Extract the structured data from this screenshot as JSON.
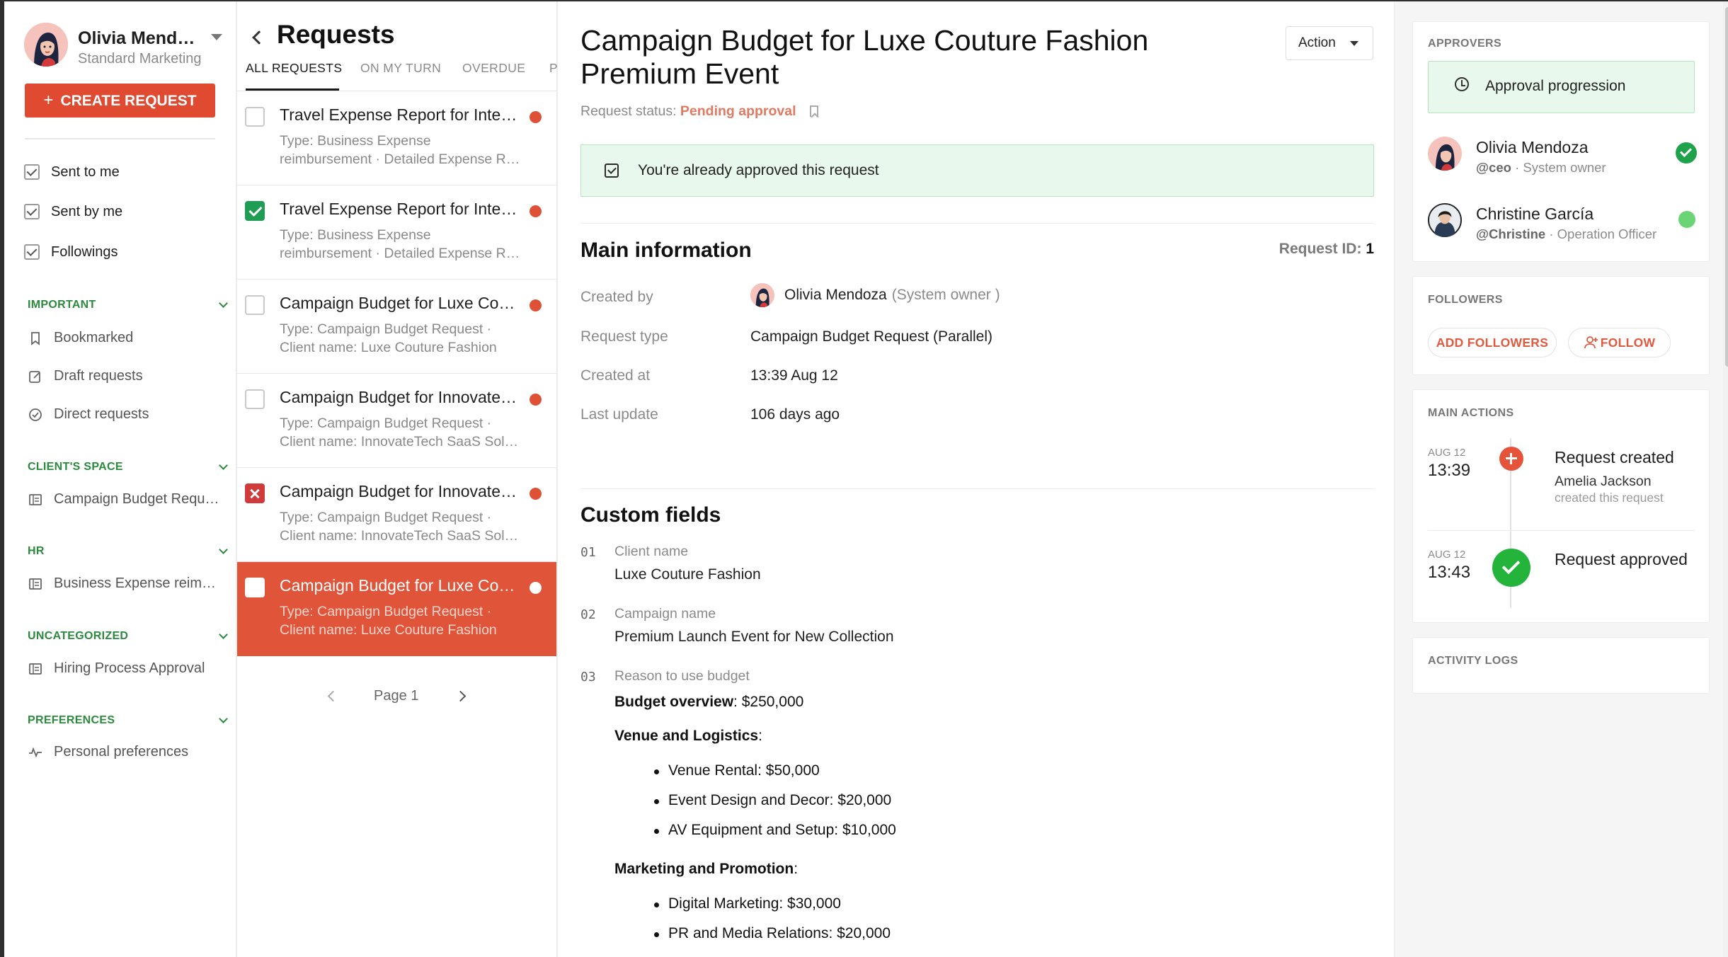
{
  "user": {
    "name": "Olivia Mendoza",
    "role": "Standard Marketing"
  },
  "sidebar": {
    "create_label": "CREATE REQUEST",
    "filters": [
      {
        "label": "Sent to me",
        "checked": true
      },
      {
        "label": "Sent by me",
        "checked": true
      },
      {
        "label": "Followings",
        "checked": true
      }
    ],
    "sections": [
      {
        "title": "IMPORTANT",
        "items": [
          {
            "label": "Bookmarked",
            "icon": "bookmark-icon"
          },
          {
            "label": "Draft requests",
            "icon": "edit-icon"
          },
          {
            "label": "Direct requests",
            "icon": "check-circle-icon"
          }
        ]
      },
      {
        "title": "CLIENT'S SPACE",
        "items": [
          {
            "label": "Campaign Budget Request",
            "icon": "form-icon"
          }
        ]
      },
      {
        "title": "HR",
        "items": [
          {
            "label": "Business Expense reimbursement",
            "icon": "form-icon"
          }
        ]
      },
      {
        "title": "UNCATEGORIZED",
        "items": [
          {
            "label": "Hiring Process Approval",
            "icon": "form-icon"
          }
        ]
      },
      {
        "title": "PREFERENCES",
        "items": [
          {
            "label": "Personal preferences",
            "icon": "pulse-icon"
          }
        ]
      }
    ]
  },
  "list": {
    "title": "Requests",
    "tabs": [
      "ALL REQUESTS",
      "ON MY TURN",
      "OVERDUE",
      "P"
    ],
    "items": [
      {
        "title": "Travel Expense Report for International Conference",
        "sub1": "Type: Business Expense",
        "sub2": "reimbursement · Detailed Expense Report",
        "state": "unchecked"
      },
      {
        "title": "Travel Expense Report for International Conference",
        "sub1": "Type: Business Expense",
        "sub2": "reimbursement · Detailed Expense Report",
        "state": "checked"
      },
      {
        "title": "Campaign Budget for Luxe Couture Fashion",
        "sub1": "Type: Campaign Budget Request ·",
        "sub2": "Client name: Luxe Couture Fashion",
        "state": "unchecked"
      },
      {
        "title": "Campaign Budget for InnovateTech SaaS",
        "sub1": "Type: Campaign Budget Request ·",
        "sub2": "Client name: InnovateTech SaaS Solutions",
        "state": "unchecked"
      },
      {
        "title": "Campaign Budget for InnovateTech SaaS",
        "sub1": "Type: Campaign Budget Request ·",
        "sub2": "Client name: InnovateTech SaaS Solutions",
        "state": "rejected"
      },
      {
        "title": "Campaign Budget for Luxe Couture Fashion",
        "sub1": "Type: Campaign Budget Request ·",
        "sub2": "Client name: Luxe Couture Fashion",
        "state": "selected"
      }
    ],
    "page_label": "Page 1"
  },
  "detail": {
    "title": "Campaign Budget for Luxe Couture Fashion Premium Event",
    "action_label": "Action",
    "status_label": "Request status:",
    "status_value": "Pending approval",
    "banner": "You're already approved this request",
    "main_info_title": "Main information",
    "request_id_label": "Request ID:",
    "request_id": "1",
    "info": {
      "created_by_label": "Created by",
      "created_by": "Olivia Mendoza",
      "created_by_role": "(System owner )",
      "type_label": "Request type",
      "type": "Campaign Budget Request  (Parallel)",
      "created_at_label": "Created at",
      "created_at": "13:39 Aug 12",
      "updated_label": "Last update",
      "updated": "106 days ago"
    },
    "custom_title": "Custom fields",
    "fields": [
      {
        "num": "01",
        "label": "Client name",
        "value": "Luxe Couture Fashion"
      },
      {
        "num": "02",
        "label": "Campaign name",
        "value": "Premium Launch Event for New Collection"
      },
      {
        "num": "03",
        "label": "Reason to use budget"
      }
    ],
    "budget": {
      "overview_label": "Budget overview",
      "overview_value": ": $250,000",
      "venue_label": "Venue and Logistics",
      "venue_items": [
        "Venue Rental: $50,000",
        "Event Design and Decor: $20,000",
        "AV Equipment and Setup: $10,000"
      ],
      "marketing_label": "Marketing and Promotion",
      "marketing_items": [
        "Digital Marketing: $30,000",
        "PR and Media Relations: $20,000"
      ]
    }
  },
  "right": {
    "approvers_title": "APPROVERS",
    "progression": "Approval progression",
    "approvers": [
      {
        "name": "Olivia Mendoza",
        "handle": "@ceo",
        "role": "· System owner",
        "status": "approved"
      },
      {
        "name": "Christine García",
        "handle": "@Christine",
        "role": "· Operation Officer",
        "status": "online"
      }
    ],
    "followers_title": "FOLLOWERS",
    "add_followers": "ADD FOLLOWERS",
    "follow": "FOLLOW",
    "actions_title": "MAIN ACTIONS",
    "actions": [
      {
        "date": "AUG 12",
        "time": "13:39",
        "title": "Request created",
        "who": "Amelia Jackson",
        "sub": "created this request"
      },
      {
        "date": "AUG 12",
        "time": "13:43",
        "title": "Request approved"
      }
    ],
    "logs_title": "ACTIVITY LOGS"
  },
  "colors": {
    "accent": "#df4a31",
    "success": "#1fa34a",
    "section": "#2b8a3e"
  }
}
